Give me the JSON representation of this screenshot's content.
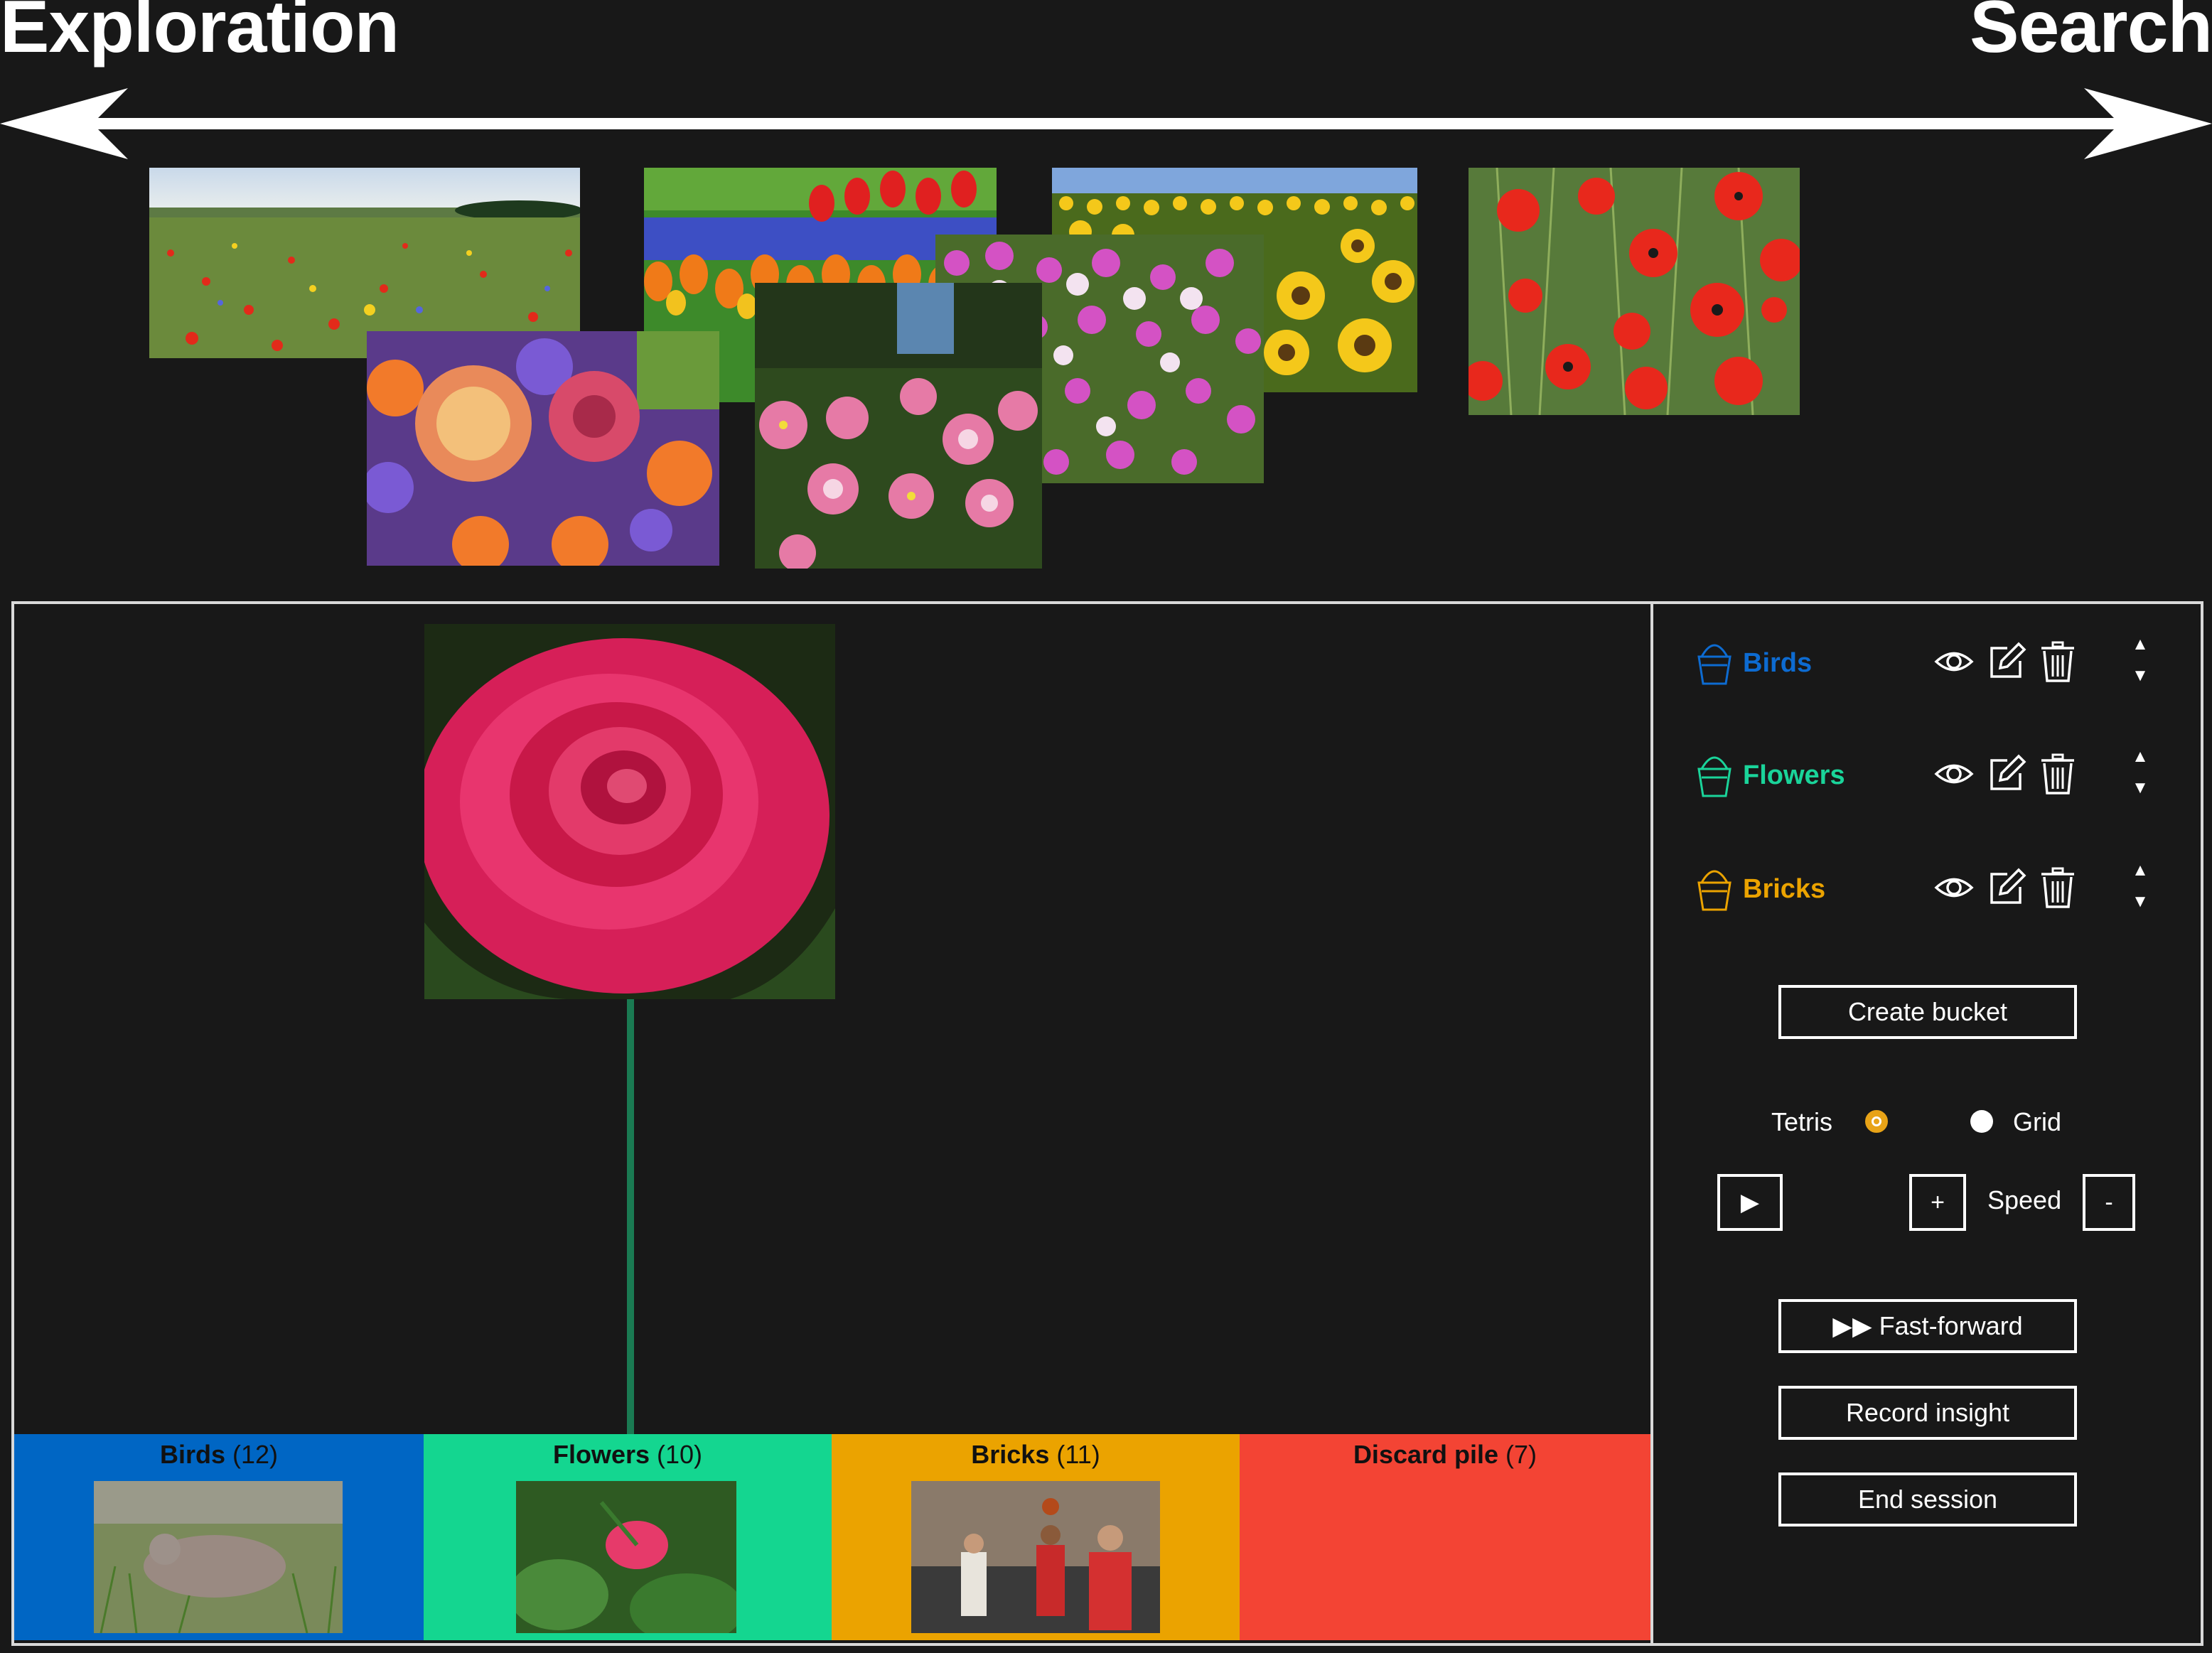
{
  "axis": {
    "left_label": "Exploration",
    "right_label": "Search"
  },
  "main": {
    "buckets_bar": [
      {
        "name": "Birds",
        "count": "(12)",
        "color": "#0066c4"
      },
      {
        "name": "Flowers",
        "count": "(10)",
        "color": "#14d690"
      },
      {
        "name": "Bricks",
        "count": "(11)",
        "color": "#eba300"
      },
      {
        "name": "Discard pile",
        "count": "(7)",
        "color": "#f34434"
      }
    ]
  },
  "panel": {
    "buckets": [
      {
        "name": "Birds",
        "color": "#0d6bd1"
      },
      {
        "name": "Flowers",
        "color": "#1ad49a"
      },
      {
        "name": "Bricks",
        "color": "#eba300"
      }
    ],
    "create_bucket_label": "Create bucket",
    "view_mode": {
      "tetris_label": "Tetris",
      "grid_label": "Grid",
      "selected": "Tetris"
    },
    "playback": {
      "play_label": "▶",
      "plus_label": "+",
      "speed_label": "Speed",
      "minus_label": "-"
    },
    "fast_forward_label": "▶▶ Fast-forward",
    "record_insight_label": "Record insight",
    "end_session_label": "End session",
    "icons": {
      "view": "eye-icon",
      "edit": "edit-icon",
      "delete": "trash-icon",
      "up": "sort-up-icon",
      "down": "sort-down-icon"
    }
  }
}
